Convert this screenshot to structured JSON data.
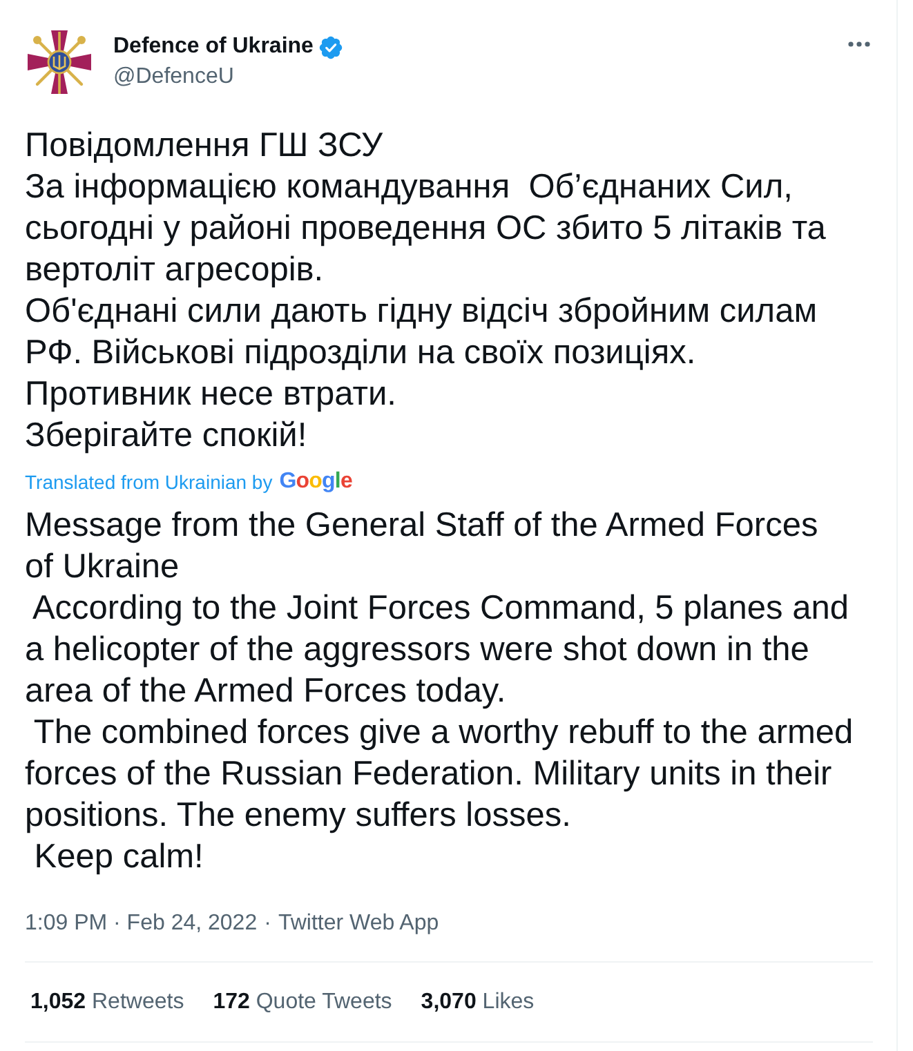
{
  "author": {
    "name": "Defence of Ukraine",
    "handle": "@DefenceU",
    "verified": true
  },
  "tweet": {
    "lines": [
      "Повідомлення ГШ ЗСУ",
      "За інформацією командування  Об’єднаних Сил,",
      "сьогодні у районі проведення ОС збито 5 літаків та",
      "вертоліт агресорів.",
      "Об'єднані сили дають гідну відсіч збройним силам",
      "РФ. Військові підрозділи на своїх позиціях.",
      "Противник несе втрати.",
      "Зберігайте спокій!"
    ],
    "translation_note": "Translated from Ukrainian by",
    "translation_provider": "Google",
    "translated_lines": [
      "Message from the General Staff of the Armed Forces",
      "of Ukraine",
      " According to the Joint Forces Command, 5 planes and",
      "a helicopter of the aggressors were shot down in the",
      "area of the Armed Forces today.",
      " The combined forces give a worthy rebuff to the armed",
      "forces of the Russian Federation. Military units in their",
      "positions. The enemy suffers losses.",
      " Keep calm!"
    ]
  },
  "meta": {
    "timestamp": "1:09 PM · Feb 24, 2022",
    "separator": "·",
    "source": "Twitter Web App"
  },
  "stats": [
    {
      "count": "1,052",
      "label": "Retweets"
    },
    {
      "count": "172",
      "label": "Quote Tweets"
    },
    {
      "count": "3,070",
      "label": "Likes"
    }
  ]
}
